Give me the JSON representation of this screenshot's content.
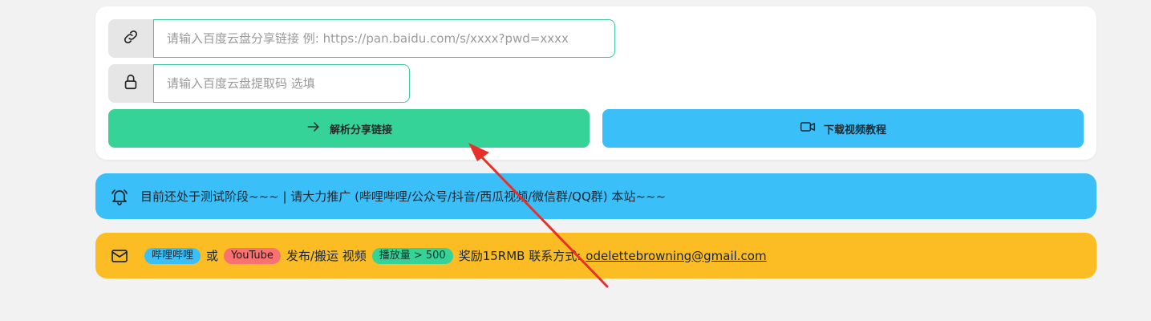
{
  "form": {
    "link_placeholder": "请输入百度云盘分享链接 例: https://pan.baidu.com/s/xxxx?pwd=xxxx",
    "link_value": "",
    "pwd_placeholder": "请输入百度云盘提取码 选填",
    "pwd_value": "",
    "link_icon": "link-icon",
    "lock_icon": "lock-icon"
  },
  "buttons": {
    "parse_label": "解析分享链接",
    "parse_icon": "arrow-right-icon",
    "video_label": "下载视频教程",
    "video_icon": "video-camera-icon"
  },
  "notices": {
    "info_icon": "bell-icon",
    "info_text": "目前还处于测试阶段~~~ | 请大力推广 (哔哩哔哩/公众号/抖音/西瓜视频/微信群/QQ群) 本站~~~",
    "promo_icon": "mail-icon",
    "promo_badge1": "哔哩哔哩",
    "promo_or": "或",
    "promo_badge2": "YouTube",
    "promo_mid": "发布/搬运 视频",
    "promo_badge3": "播放量 > 500",
    "promo_reward": "奖励15RMB 联系方式:",
    "promo_email": "odelettebrowning@gmail.com"
  },
  "colors": {
    "page_bg": "#f2f2f2",
    "primary_green": "#36d399",
    "info_blue": "#3abff8",
    "warning_yellow": "#fbbd23",
    "error_red": "#f87272",
    "annotation_arrow": "#e8302a"
  }
}
